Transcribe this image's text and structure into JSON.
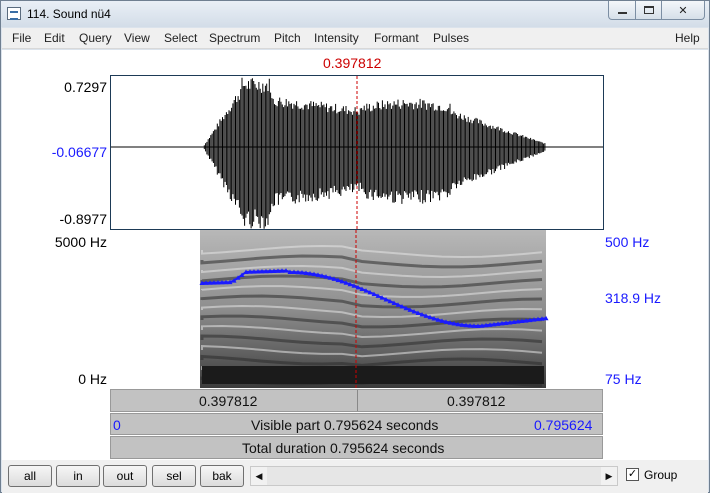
{
  "window": {
    "title": "114. Sound nü4"
  },
  "menu": [
    "File",
    "Edit",
    "Query",
    "View",
    "Select",
    "Spectrum",
    "Pitch",
    "Intensity",
    "Formant",
    "Pulses"
  ],
  "menu_help": "Help",
  "cursor_time": "0.397812",
  "waveform": {
    "y_max": "0.7297",
    "y_zero": "-0.06677",
    "y_min": "-0.8977"
  },
  "spectrogram": {
    "freq_top": "5000 Hz",
    "freq_bottom": "0 Hz",
    "pitch_top": "500 Hz",
    "pitch_value": "318.9 Hz",
    "pitch_bottom": "75 Hz",
    "pitch_color": "#1a1aff"
  },
  "selection_bar": {
    "left": "0.397812",
    "right": "0.397812"
  },
  "visible_bar": {
    "start": "0",
    "text": "Visible part 0.795624 seconds",
    "end": "0.795624"
  },
  "total_bar": {
    "text": "Total duration 0.795624 seconds"
  },
  "toolbar": {
    "buttons": [
      "all",
      "in",
      "out",
      "sel",
      "bak"
    ],
    "group_label": "Group",
    "group_checked": "✓"
  },
  "colors": {
    "cursor": "#cc0000",
    "accent": "#1a1aff"
  }
}
